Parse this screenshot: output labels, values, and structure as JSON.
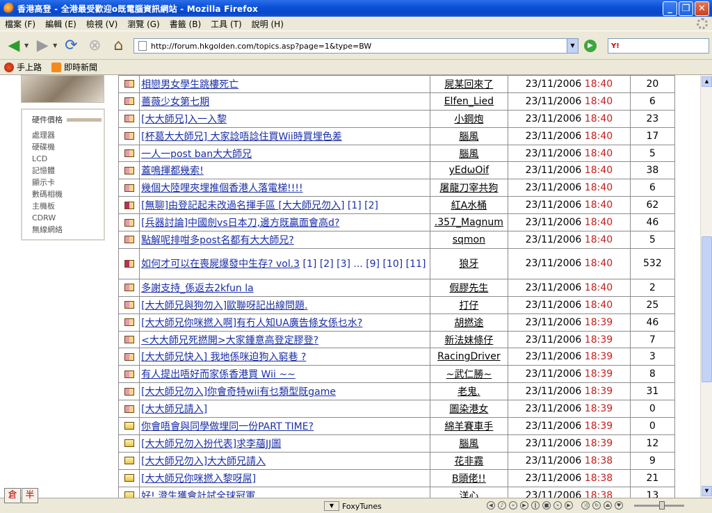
{
  "window": {
    "title": "香港高登 - 全港最受歡迎o既電腦資訊網站 - Mozilla Firefox",
    "min": "_",
    "max": "❐",
    "close": "✕"
  },
  "menu": [
    "檔案 (F)",
    "編輯 (E)",
    "檢視 (V)",
    "瀏覽 (G)",
    "書籤 (B)",
    "工具 (T)",
    "說明 (H)"
  ],
  "nav": {
    "url": "http://forum.hkgolden.com/topics.asp?page=1&type=BW",
    "search_engine": "Y!",
    "search_value": ""
  },
  "bookmarks": [
    "手上路",
    "即時新聞"
  ],
  "sidebar": {
    "heading": "硬件價格",
    "items": [
      "處理器",
      "硬碟機",
      "LCD",
      "記憶體",
      "顯示卡",
      "數碼相機",
      "主機板",
      "CDRW",
      "無線網絡"
    ]
  },
  "topics": [
    {
      "icon": "hot",
      "title": "相戀男女學生跳樓死亡",
      "pages": "",
      "author": "屍某回來了",
      "date": "23/11/2006",
      "time": "18:40",
      "replies": "20"
    },
    {
      "icon": "hot",
      "title": "薔薇少女第七期",
      "pages": "",
      "author": "Elfen_Lied",
      "date": "23/11/2006",
      "time": "18:40",
      "replies": "6"
    },
    {
      "icon": "hot",
      "title": "[大大師兄]入一入黎",
      "pages": "",
      "author": "小鋼炮",
      "date": "23/11/2006",
      "time": "18:40",
      "replies": "23"
    },
    {
      "icon": "hot",
      "title": "[杯葛大大師兄] 大家諗唔諗住買Wii時買埋色差",
      "pages": "",
      "author": "腦風",
      "date": "23/11/2006",
      "time": "18:40",
      "replies": "17"
    },
    {
      "icon": "hot",
      "title": "一人一post ban大大師兄",
      "pages": "",
      "author": "腦風",
      "date": "23/11/2006",
      "time": "18:40",
      "replies": "5"
    },
    {
      "icon": "hot",
      "title": "蓋鳴揮都幾索!",
      "pages": "",
      "author": "yEdωOif",
      "date": "23/11/2006",
      "time": "18:40",
      "replies": "38"
    },
    {
      "icon": "hot",
      "title": "幾個大陸哩夾埋推個香港人落電梯!!!!",
      "pages": "",
      "author": "屠龍刀宰共狗",
      "date": "23/11/2006",
      "time": "18:40",
      "replies": "6"
    },
    {
      "icon": "vhot",
      "title": "[無聊]由登記起未改過名揮手區 [大大師兄勿入]",
      "pages": "[1] [2]",
      "author": "紅A水桶",
      "date": "23/11/2006",
      "time": "18:40",
      "replies": "62"
    },
    {
      "icon": "hot",
      "title": "[兵器討論]中國劍vs日本刀,邊方既贏面會高d?",
      "pages": "",
      "author": ".357_Magnum",
      "date": "23/11/2006",
      "time": "18:40",
      "replies": "46"
    },
    {
      "icon": "hot",
      "title": "點解呢排咁多post名都有大大師兄?",
      "pages": "",
      "author": "sqmon",
      "date": "23/11/2006",
      "time": "18:40",
      "replies": "5"
    },
    {
      "icon": "vhot",
      "title": "如何才可以在喪屍爆發中生存? vol.3",
      "pages": "[1] [2] [3] ... [9] [10] [11]",
      "author": "狼牙",
      "date": "23/11/2006",
      "time": "18:40",
      "replies": "532",
      "tall": true
    },
    {
      "icon": "hot",
      "title": "多謝支持_係返去2kfun la",
      "pages": "",
      "author": "假膠先生",
      "date": "23/11/2006",
      "time": "18:40",
      "replies": "2"
    },
    {
      "icon": "hot",
      "title": "[大大師兄與狗勿入]歐聯呀記出線問題.",
      "pages": "",
      "author": "打仔",
      "date": "23/11/2006",
      "time": "18:40",
      "replies": "25"
    },
    {
      "icon": "hot",
      "title": "[大大師兄你咪撚入啊]有冇人知UA廣告條女係乜水?",
      "pages": "",
      "author": "胡撚途",
      "date": "23/11/2006",
      "time": "18:39",
      "replies": "46"
    },
    {
      "icon": "hot",
      "title": "<大大師兄死撚開>大家鍾意高登定膠登?",
      "pages": "",
      "author": "新法妹條仔",
      "date": "23/11/2006",
      "time": "18:39",
      "replies": "7"
    },
    {
      "icon": "hot",
      "title": "[大大師兄快入] 我地係咪迫狗入窮巷 ?",
      "pages": "",
      "author": "RacingDriver",
      "date": "23/11/2006",
      "time": "18:39",
      "replies": "3"
    },
    {
      "icon": "hot",
      "title": "有人提出唔好而家係香港買 Wii ~~",
      "pages": "",
      "author": "~武仁勝~",
      "date": "23/11/2006",
      "time": "18:39",
      "replies": "8"
    },
    {
      "icon": "hot",
      "title": "[大大師兄勿入]你會奇特wii有乜類型既game",
      "pages": "",
      "author": "老鬼.",
      "date": "23/11/2006",
      "time": "18:39",
      "replies": "31"
    },
    {
      "icon": "hot",
      "title": "[大大師兄請入]",
      "pages": "",
      "author": "圖染港女",
      "date": "23/11/2006",
      "time": "18:39",
      "replies": "0"
    },
    {
      "icon": "norm",
      "title": "你會唔會與同學做埋同一份PART TIME?",
      "pages": "",
      "author": "綿羊賽車手",
      "date": "23/11/2006",
      "time": "18:39",
      "replies": "0"
    },
    {
      "icon": "norm",
      "title": "[大大師兄勿入扮代表]求李蘊JJ圖",
      "pages": "",
      "author": "腦風",
      "date": "23/11/2006",
      "time": "18:39",
      "replies": "12"
    },
    {
      "icon": "norm",
      "title": "[大大師兄勿入]大大師兄請入",
      "pages": "",
      "author": "花非霧",
      "date": "23/11/2006",
      "time": "18:38",
      "replies": "9"
    },
    {
      "icon": "norm",
      "title": "[大大師兄你咪撚入黎呀屌]",
      "pages": "",
      "author": "B頭佬!!",
      "date": "23/11/2006",
      "time": "18:38",
      "replies": "21"
    },
    {
      "icon": "norm",
      "title": "好! 澄生獲會計試全球冠軍.",
      "pages": "",
      "author": "洋心",
      "date": "23/11/2006",
      "time": "18:38",
      "replies": "13"
    }
  ],
  "status": {
    "ime1": "倉",
    "ime2": "半",
    "foxy_label": "FoxyTunes"
  },
  "colors": {
    "link": "#1a2ea6",
    "time": "#c41e1e",
    "titlebar": "#0a4fd6"
  }
}
